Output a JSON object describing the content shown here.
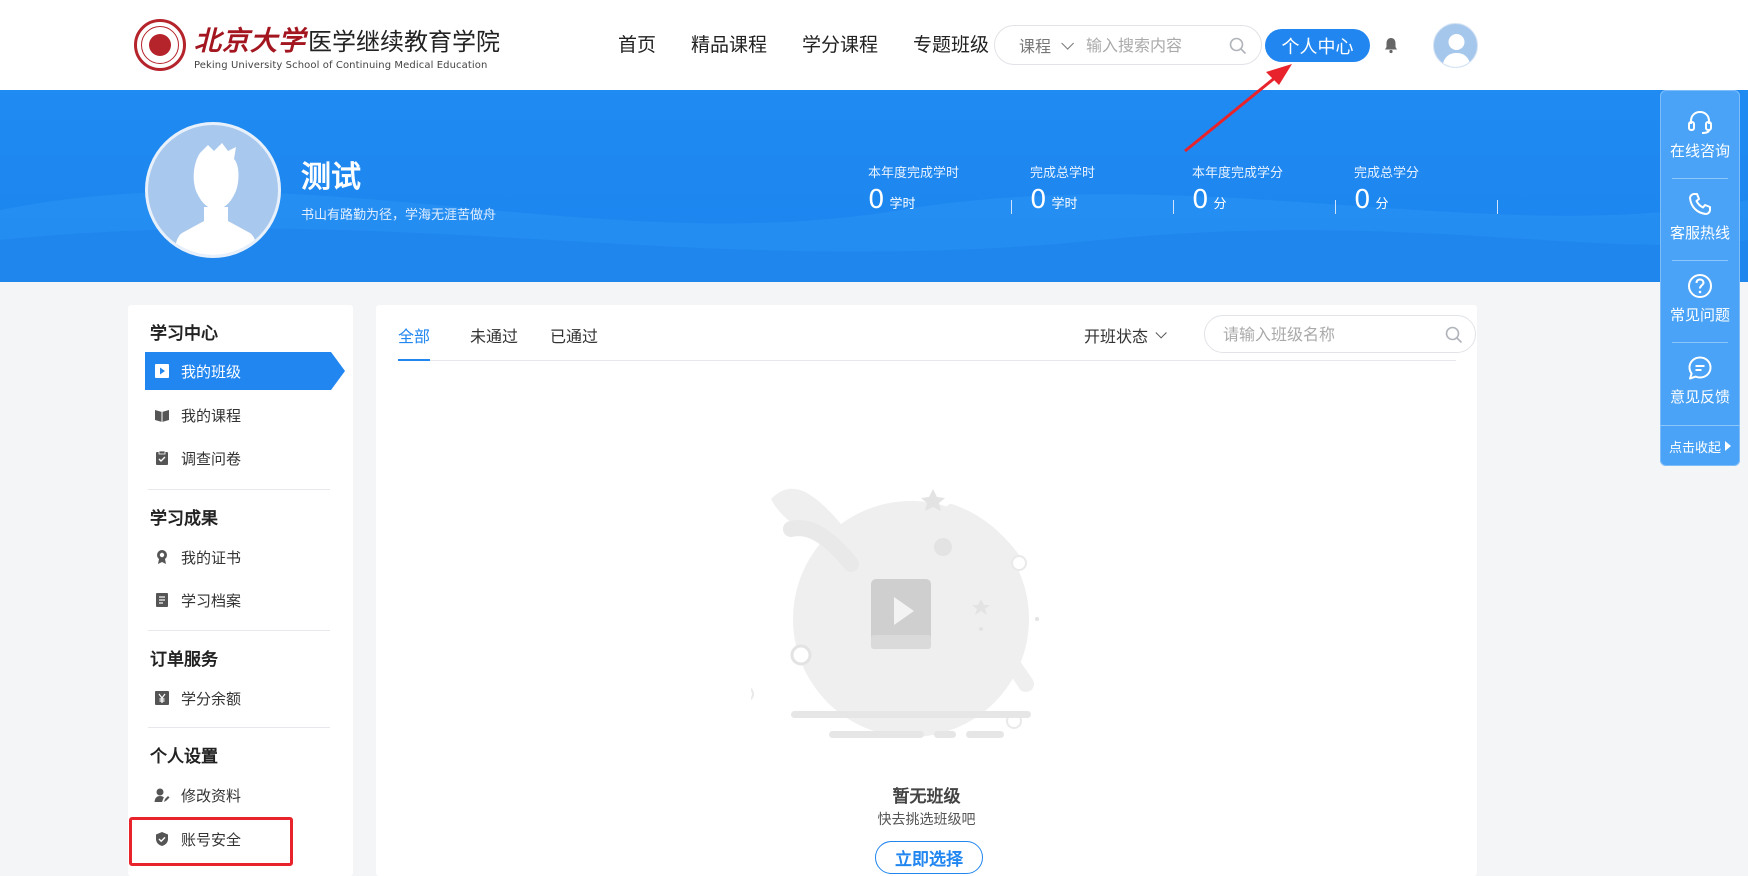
{
  "header": {
    "logo_cn_pku": "北京大学",
    "logo_cn_school": "医学继续教育学院",
    "logo_en": "Peking University School of Continuing Medical Education",
    "nav": [
      {
        "label": "首页"
      },
      {
        "label": "精品课程"
      },
      {
        "label": "学分课程"
      },
      {
        "label": "专题班级"
      }
    ],
    "search": {
      "category": "课程",
      "placeholder": "输入搜索内容"
    },
    "personal_center_label": "个人中心"
  },
  "profile": {
    "name": "测试",
    "motto": "书山有路勤为径，学海无涯苦做舟",
    "stats": [
      {
        "label": "本年度完成学时",
        "value": "0",
        "unit": "学时"
      },
      {
        "label": "完成总学时",
        "value": "0",
        "unit": "学时"
      },
      {
        "label": "本年度完成学分",
        "value": "0",
        "unit": "分"
      },
      {
        "label": "完成总学分",
        "value": "0",
        "unit": "分"
      }
    ]
  },
  "sidebar": {
    "groups": [
      {
        "title": "学习中心",
        "items": [
          {
            "label": "我的班级",
            "icon": "play-book-icon",
            "active": true
          },
          {
            "label": "我的课程",
            "icon": "open-book-icon"
          },
          {
            "label": "调查问卷",
            "icon": "clipboard-icon"
          }
        ]
      },
      {
        "title": "学习成果",
        "items": [
          {
            "label": "我的证书",
            "icon": "certificate-icon"
          },
          {
            "label": "学习档案",
            "icon": "archive-icon"
          }
        ]
      },
      {
        "title": "订单服务",
        "items": [
          {
            "label": "学分余额",
            "icon": "yuan-icon"
          }
        ]
      },
      {
        "title": "个人设置",
        "items": [
          {
            "label": "修改资料",
            "icon": "user-edit-icon"
          },
          {
            "label": "账号安全",
            "icon": "shield-icon"
          }
        ]
      }
    ]
  },
  "main": {
    "tabs": [
      {
        "label": "全部",
        "active": true
      },
      {
        "label": "未通过"
      },
      {
        "label": "已通过"
      }
    ],
    "filter_label": "开班状态",
    "class_search_placeholder": "请输入班级名称",
    "empty_title": "暂无班级",
    "empty_subtitle": "快去挑选班级吧",
    "select_button": "立即选择"
  },
  "float_panel": {
    "items": [
      {
        "label": "在线咨询",
        "icon": "headset-icon"
      },
      {
        "label": "客服热线",
        "icon": "phone-icon"
      },
      {
        "label": "常见问题",
        "icon": "question-icon"
      },
      {
        "label": "意见反馈",
        "icon": "chat-icon"
      }
    ],
    "collapse_label": "点击收起"
  },
  "colors": {
    "primary": "#2186f0",
    "banner": "#1f8bf2",
    "float_panel": "#4aa3f6",
    "highlight": "#e8232b",
    "logo_red": "#a3161f"
  }
}
